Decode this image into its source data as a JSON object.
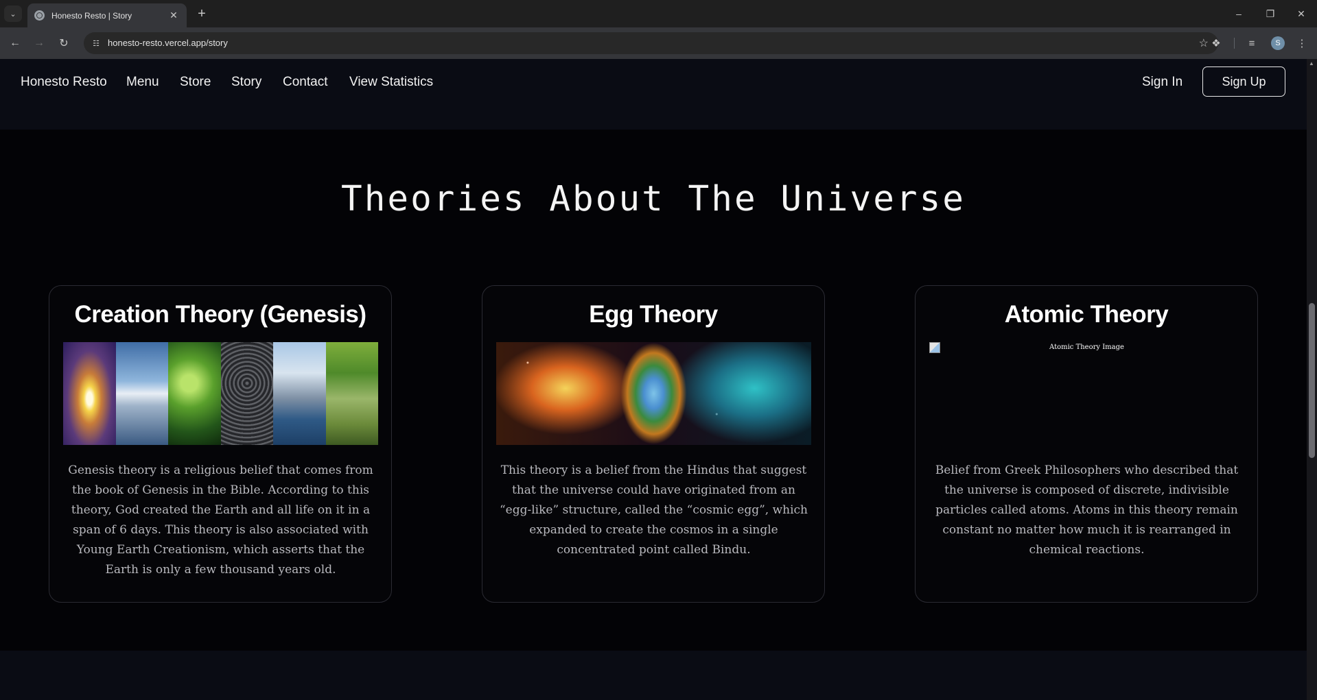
{
  "browser": {
    "tab_title": "Honesto Resto | Story",
    "new_tab": "+",
    "url": "honesto-resto.vercel.app/story",
    "profile_initial": "S"
  },
  "header": {
    "brand": "Honesto Resto",
    "nav": [
      "Menu",
      "Store",
      "Story",
      "Contact",
      "View Statistics"
    ],
    "sign_in": "Sign In",
    "sign_up": "Sign Up"
  },
  "section": {
    "title": "Theories About The Universe"
  },
  "cards": [
    {
      "title": "Creation Theory (Genesis)",
      "image": "genesis-creation-panels",
      "text": "Genesis theory is a religious belief that comes from the book of Genesis in the Bible. According to this theory, God created the Earth and all life on it in a span of 6 days. This theory is also associated with Young Earth Creationism, which asserts that the Earth is only a few thousand years old."
    },
    {
      "title": "Egg Theory",
      "image": "cosmic-egg-nebula",
      "text": "This theory is a belief from the Hindus that suggest that the universe could have originated from an “egg-like” structure, called the “cosmic egg”, which expanded to create the cosmos in a single concentrated point called Bindu."
    },
    {
      "title": "Atomic Theory",
      "image_alt": "Atomic Theory Image",
      "text": "Belief from Greek Philosophers who described that the universe is composed of discrete, indivisible particles called atoms. Atoms in this theory remain constant no matter how much it is rearranged in chemical reactions."
    }
  ],
  "colors": {
    "page_bg": "#030306",
    "header_bg": "#0a0c14",
    "card_border": "#2b2b33",
    "body_text": "#b9b9be"
  }
}
